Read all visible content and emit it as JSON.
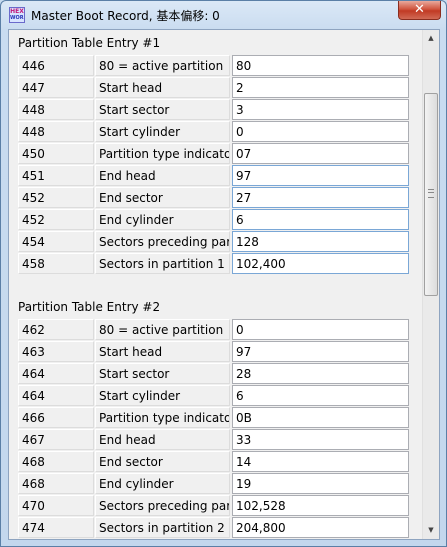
{
  "window": {
    "title": "Master Boot Record, 基本偏移: 0",
    "app_icon_text_top": "HEX",
    "app_icon_text_bottom": "WORKS",
    "close_glyph": "✕"
  },
  "sections": [
    {
      "title": "Partition Table Entry #1",
      "rows": [
        {
          "offset": "446",
          "name": "80 = active partition",
          "value": "80"
        },
        {
          "offset": "447",
          "name": "Start head",
          "value": "2"
        },
        {
          "offset": "448",
          "name": "Start sector",
          "value": "3"
        },
        {
          "offset": "448",
          "name": "Start cylinder",
          "value": "0"
        },
        {
          "offset": "450",
          "name": "Partition type indicator",
          "value": "07"
        },
        {
          "offset": "451",
          "name": "End head",
          "value": "97"
        },
        {
          "offset": "452",
          "name": "End sector",
          "value": "27"
        },
        {
          "offset": "452",
          "name": "End cylinder",
          "value": "6"
        },
        {
          "offset": "454",
          "name": "Sectors preceding partition",
          "value": "128"
        },
        {
          "offset": "458",
          "name": "Sectors in partition 1",
          "value": "102,400"
        }
      ]
    },
    {
      "title": "Partition Table Entry #2",
      "rows": [
        {
          "offset": "462",
          "name": "80 = active partition",
          "value": "0"
        },
        {
          "offset": "463",
          "name": "Start head",
          "value": "97"
        },
        {
          "offset": "464",
          "name": "Start sector",
          "value": "28"
        },
        {
          "offset": "464",
          "name": "Start cylinder",
          "value": "6"
        },
        {
          "offset": "466",
          "name": "Partition type indicator",
          "value": "0B"
        },
        {
          "offset": "467",
          "name": "End head",
          "value": "33"
        },
        {
          "offset": "468",
          "name": "End sector",
          "value": "14"
        },
        {
          "offset": "468",
          "name": "End cylinder",
          "value": "19"
        },
        {
          "offset": "470",
          "name": "Sectors preceding partition",
          "value": "102,528"
        },
        {
          "offset": "474",
          "name": "Sectors in partition 2",
          "value": "204,800"
        }
      ]
    }
  ],
  "scrollbar": {
    "up_glyph": "▲",
    "down_glyph": "▼"
  }
}
